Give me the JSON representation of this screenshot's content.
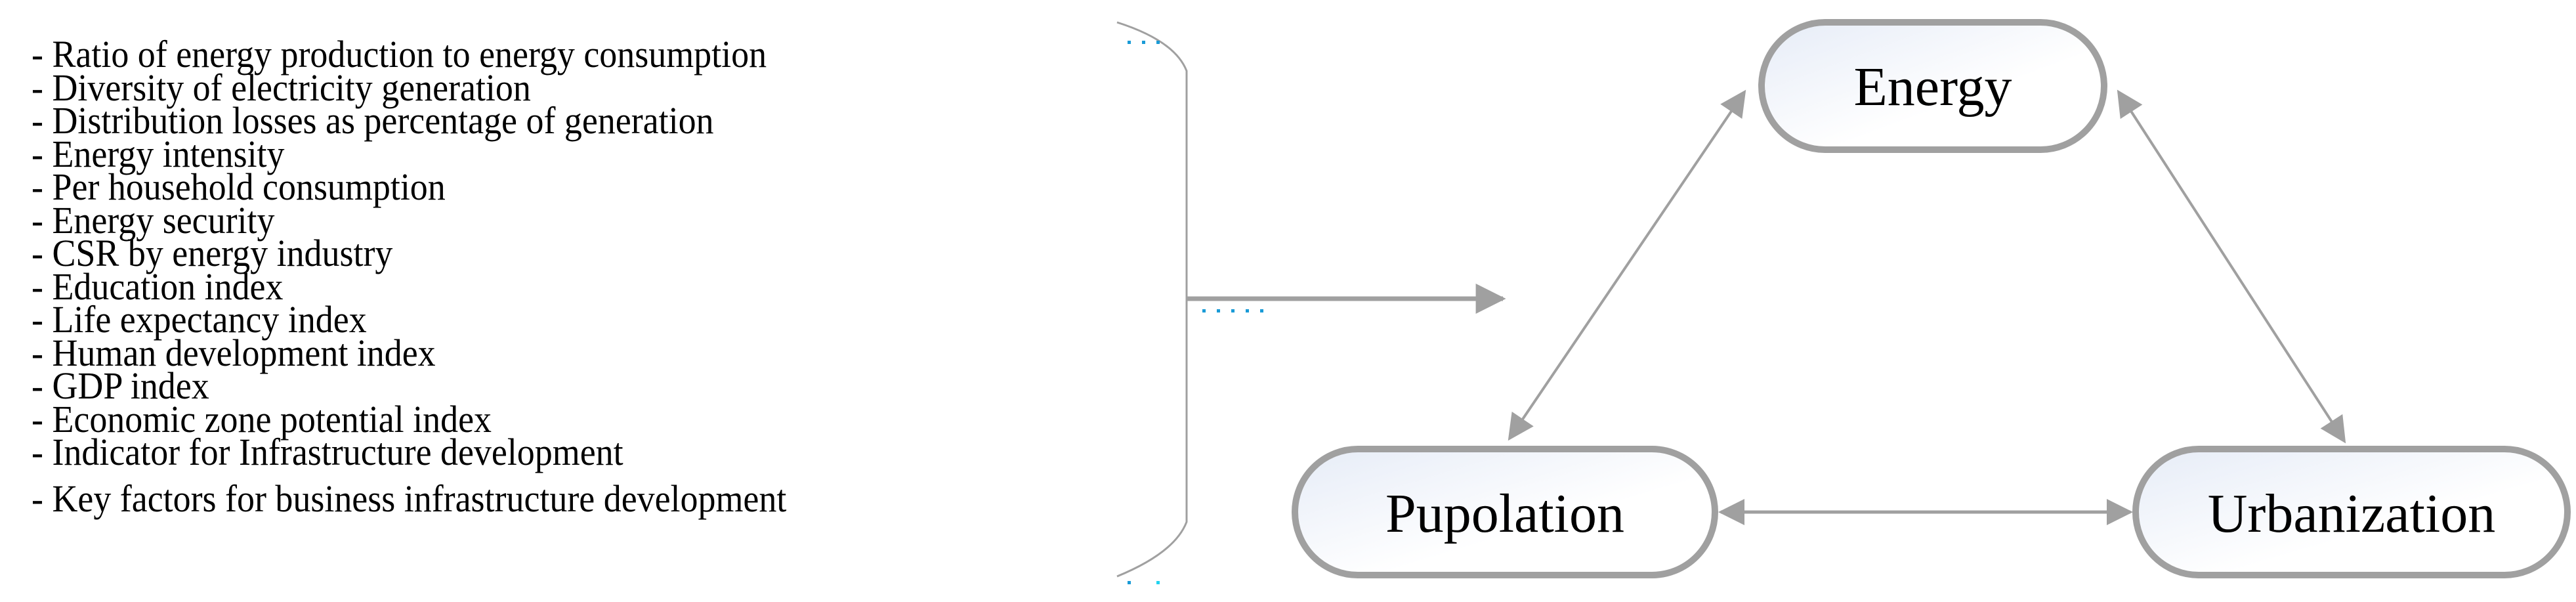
{
  "indicators": {
    "items": [
      "- Ratio of energy production to energy consumption",
      "- Diversity of electricity generation",
      "- Distribution losses as percentage of generation",
      "- Energy intensity",
      "- Per household consumption",
      "- Energy security",
      "- CSR by energy industry",
      "- Education index",
      "- Life expectancy index",
      "- Human development index",
      "- GDP index",
      "- Economic zone potential index",
      "- Indicator for Infrastructure development",
      "- Key factors for business infrastructure development"
    ]
  },
  "nodes": {
    "energy": "Energy",
    "population": "Pupolation",
    "urbanization": "Urbanization"
  },
  "edges": [
    {
      "from": "energy",
      "to": "population",
      "type": "bidirectional"
    },
    {
      "from": "energy",
      "to": "urbanization",
      "type": "bidirectional"
    },
    {
      "from": "population",
      "to": "urbanization",
      "type": "bidirectional"
    },
    {
      "from": "indicators",
      "to": "triangle",
      "type": "directed"
    }
  ],
  "colors": {
    "line": "#a0a0a0",
    "node_fill_start": "#e8eef8",
    "node_fill_end": "#ffffff",
    "guide_dots": "#1a9bd7"
  }
}
